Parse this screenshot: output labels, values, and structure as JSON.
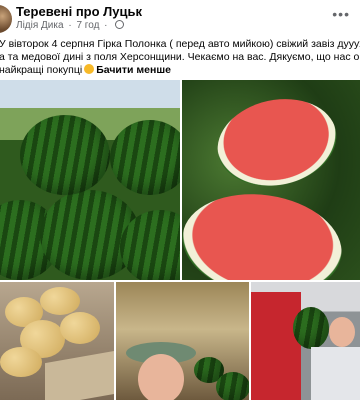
{
  "post": {
    "group_name": "Теревені про Луцьк",
    "author": "Лідія Дика",
    "time": "7 год",
    "text_line1": "У вівторок 4 серпня Гірка Полонка ( перед авто мийкою) свіжий завіз дуууже солодкого кавун",
    "text_line2": "а та медової дині з поля Херсонщини. Чекаємо на вас. Дякуємо, що нас обираєте, Ви в нас",
    "text_line3": "найкращі покупці",
    "see_less_label": "Бачити менше"
  },
  "icons": {
    "more": "more-options-icon",
    "globe": "globe-icon",
    "emoji": "smile-emoji-icon"
  }
}
